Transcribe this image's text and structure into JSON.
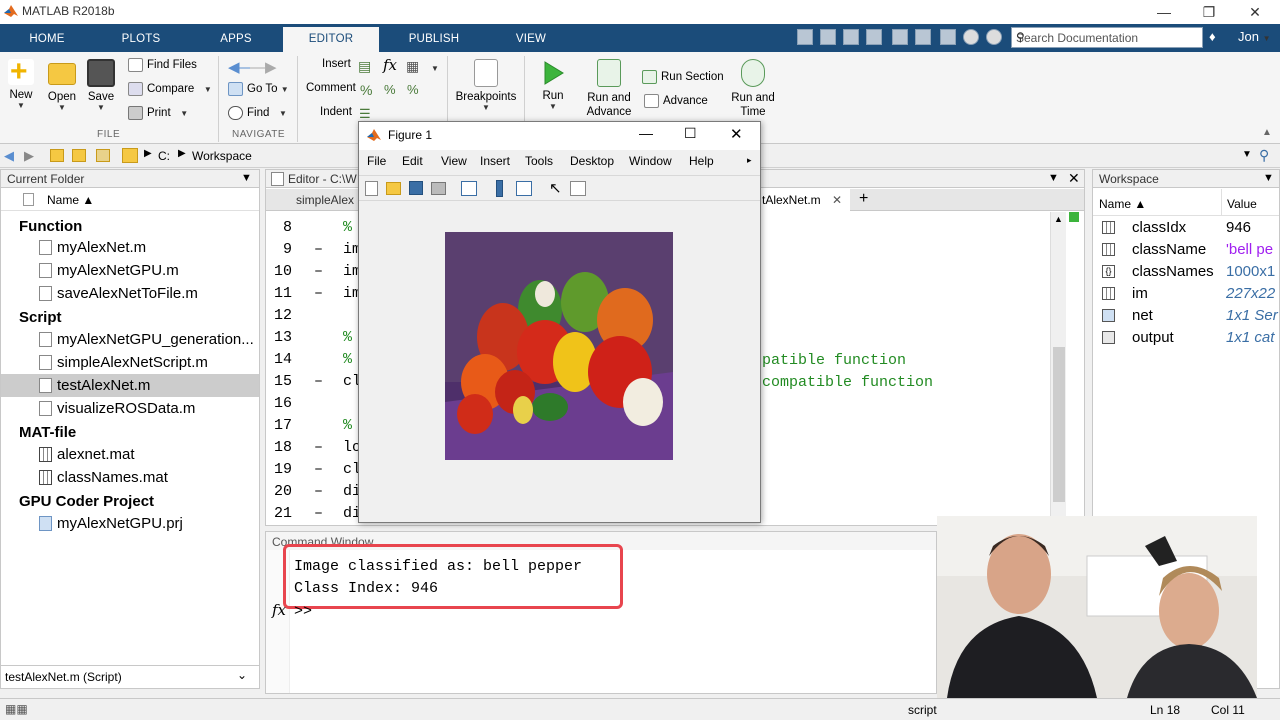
{
  "app": {
    "title": "MATLAB R2018b"
  },
  "tabs": [
    {
      "label": "HOME"
    },
    {
      "label": "PLOTS"
    },
    {
      "label": "APPS"
    },
    {
      "label": "EDITOR"
    },
    {
      "label": "PUBLISH"
    },
    {
      "label": "VIEW"
    }
  ],
  "search": {
    "placeholder": "Search Documentation"
  },
  "user": {
    "name": "Jon"
  },
  "ribbon": {
    "file": {
      "new": "New",
      "open": "Open",
      "save": "Save",
      "find_files": "Find Files",
      "compare": "Compare",
      "print": "Print",
      "section": "FILE"
    },
    "navigate": {
      "go_to": "Go To",
      "find": "Find",
      "section": "NAVIGATE"
    },
    "edit": {
      "insert": "Insert",
      "comment": "Comment",
      "indent": "Indent"
    },
    "breakpoints": "Breakpoints",
    "run": {
      "run": "Run",
      "run_and_advance": "Run and Advance",
      "run_section": "Run Section",
      "advance": "Advance",
      "run_and_time": "Run and Time"
    }
  },
  "address": {
    "drive": "C:",
    "folder": "Workspace"
  },
  "current_folder": {
    "title": "Current Folder",
    "column": "Name",
    "groups": [
      {
        "label": "Function",
        "files": [
          "myAlexNet.m",
          "myAlexNetGPU.m",
          "saveAlexNetToFile.m"
        ]
      },
      {
        "label": "Script",
        "files": [
          "myAlexNetGPU_generation...",
          "simpleAlexNetScript.m",
          "testAlexNet.m",
          "visualizeROSData.m"
        ]
      },
      {
        "label": "MAT-file",
        "files": [
          "alexnet.mat",
          "classNames.mat"
        ]
      },
      {
        "label": "GPU Coder Project",
        "files": [
          "myAlexNetGPU.prj"
        ]
      }
    ],
    "details": "testAlexNet.m  (Script)"
  },
  "editor": {
    "title": "Editor - C:\\W",
    "tab_left": "simpleAlex",
    "tab_right": "tAlexNet.m",
    "lines": [
      {
        "n": "8",
        "dash": "",
        "text": "%"
      },
      {
        "n": "9",
        "dash": "–",
        "text": "im"
      },
      {
        "n": "10",
        "dash": "–",
        "text": "im"
      },
      {
        "n": "11",
        "dash": "–",
        "text": "im"
      },
      {
        "n": "12",
        "dash": "",
        "text": ""
      },
      {
        "n": "13",
        "dash": "",
        "text": "%"
      },
      {
        "n": "14",
        "dash": "",
        "text": "%"
      },
      {
        "n": "15",
        "dash": "–",
        "text": "cl"
      },
      {
        "n": "16",
        "dash": "",
        "text": ""
      },
      {
        "n": "17",
        "dash": "",
        "text": "%"
      },
      {
        "n": "18",
        "dash": "–",
        "text": "lo"
      },
      {
        "n": "19",
        "dash": "–",
        "text": "cl"
      },
      {
        "n": "20",
        "dash": "–",
        "text": "di"
      },
      {
        "n": "21",
        "dash": "–",
        "text": "di"
      }
    ],
    "right_comment_1": "patible function",
    "right_comment_2": "compatible function"
  },
  "figure": {
    "title": "Figure 1",
    "menus": [
      "File",
      "Edit",
      "View",
      "Insert",
      "Tools",
      "Desktop",
      "Window",
      "Help"
    ]
  },
  "workspace": {
    "title": "Workspace",
    "col_name": "Name",
    "col_value": "Value",
    "vars": [
      {
        "name": "classIdx",
        "value": "946"
      },
      {
        "name": "className",
        "value": "'bell pe"
      },
      {
        "name": "classNames",
        "value": "1000x1"
      },
      {
        "name": "im",
        "value": "227x22"
      },
      {
        "name": "net",
        "value": "1x1 Ser"
      },
      {
        "name": "output",
        "value": "1x1 cat"
      }
    ]
  },
  "command": {
    "title": "Command Window",
    "line1": "Image classified as: bell pepper",
    "line2": "Class Index: 946",
    "prompt": ">>",
    "highlight_color": "#e8454e"
  },
  "status": {
    "mode": "script",
    "ln_label": "Ln",
    "ln": "18",
    "col_label": "Col",
    "col": "11"
  }
}
